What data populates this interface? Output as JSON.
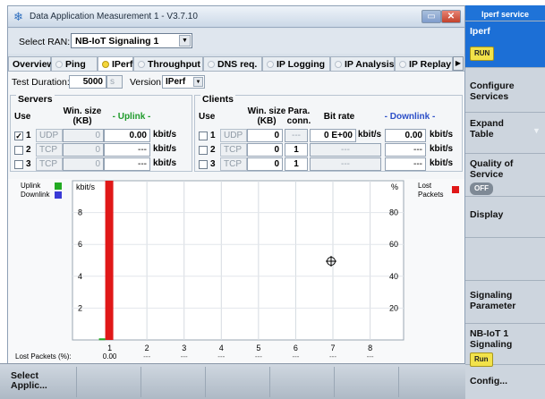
{
  "window": {
    "title": "Data Application Measurement 1 - V3.7.10",
    "ran_label": "Select RAN:",
    "ran_value": "NB-IoT Signaling 1"
  },
  "tabs": [
    {
      "label": "Overview"
    },
    {
      "label": "Ping"
    },
    {
      "label": "IPerf"
    },
    {
      "label": "Throughput"
    },
    {
      "label": "DNS req."
    },
    {
      "label": "IP Logging"
    },
    {
      "label": "IP Analysis/Security"
    },
    {
      "label": "IP Replay"
    }
  ],
  "settings": {
    "test_duration_label": "Test Duration:",
    "test_duration_value": "5000",
    "test_duration_unit": "s",
    "version_label": "Version",
    "version_value": "IPerf"
  },
  "servers": {
    "title": "Servers",
    "col_use": "Use",
    "col_win": "Win. size (KB)",
    "col_uplink": "- Uplink -",
    "rows": [
      {
        "num": "1",
        "checked": "✓",
        "proto": "UDP",
        "win": "0",
        "rate": "0.00",
        "unit": "kbit/s"
      },
      {
        "num": "2",
        "checked": "",
        "proto": "TCP",
        "win": "0",
        "rate": "---",
        "unit": "kbit/s"
      },
      {
        "num": "3",
        "checked": "",
        "proto": "TCP",
        "win": "0",
        "rate": "---",
        "unit": "kbit/s"
      }
    ]
  },
  "clients": {
    "title": "Clients",
    "col_use": "Use",
    "col_win": "Win. size (KB)",
    "col_para": "Para. conn.",
    "col_bitrate": "Bit rate",
    "col_downlink": "- Downlink -",
    "rows": [
      {
        "num": "1",
        "checked": "",
        "proto": "UDP",
        "win": "0",
        "para": "---",
        "bitrate": "0 E+00",
        "bitrate_unit": "kbit/s",
        "rate": "0.00",
        "unit": "kbit/s"
      },
      {
        "num": "2",
        "checked": "",
        "proto": "TCP",
        "win": "0",
        "para": "1",
        "bitrate": "---",
        "bitrate_unit": "",
        "rate": "---",
        "unit": "kbit/s"
      },
      {
        "num": "3",
        "checked": "",
        "proto": "TCP",
        "win": "0",
        "para": "1",
        "bitrate": "---",
        "bitrate_unit": "",
        "rate": "---",
        "unit": "kbit/s"
      }
    ]
  },
  "chart_data": {
    "type": "bar",
    "legend": [
      "Uplink",
      "Downlink",
      "Lost Packets"
    ],
    "colors": {
      "uplink": "#22aa22",
      "downlink": "#3a3ad6",
      "lost": "#e01818"
    },
    "y_left_label": "kbit/s",
    "y_right_label": "%",
    "y_left_ticks": [
      "2",
      "4",
      "6",
      "8"
    ],
    "y_right_ticks": [
      "20",
      "40",
      "60",
      "80"
    ],
    "ylim_left": [
      0,
      10
    ],
    "ylim_right": [
      0,
      100
    ],
    "categories": [
      "1",
      "2",
      "3",
      "4",
      "5",
      "6",
      "7",
      "8"
    ],
    "series": [
      {
        "name": "Uplink",
        "values": [
          0.1,
          0,
          0,
          0,
          0,
          0,
          0,
          0
        ]
      },
      {
        "name": "Lost Packets",
        "values": [
          100,
          0,
          0,
          0,
          0,
          0,
          0,
          0
        ]
      }
    ],
    "lost_packets_label": "Lost Packets (%):",
    "lost_packets_values": [
      "0.00",
      "---",
      "---",
      "---",
      "---",
      "---",
      "---",
      "---"
    ],
    "grid": true
  },
  "bottom": {
    "select_app": "Select Applic..."
  },
  "softkeys": {
    "header": "Iperf service",
    "iperf": "Iperf",
    "run": "RUN",
    "configure": "Configure Services",
    "expand": "Expand Table",
    "qos": "Quality of Service",
    "off": "OFF",
    "display": "Display",
    "signaling": "Signaling Parameter",
    "nbiot": "NB-IoT 1 Signaling",
    "nbiot_run": "Run",
    "config": "Config..."
  }
}
